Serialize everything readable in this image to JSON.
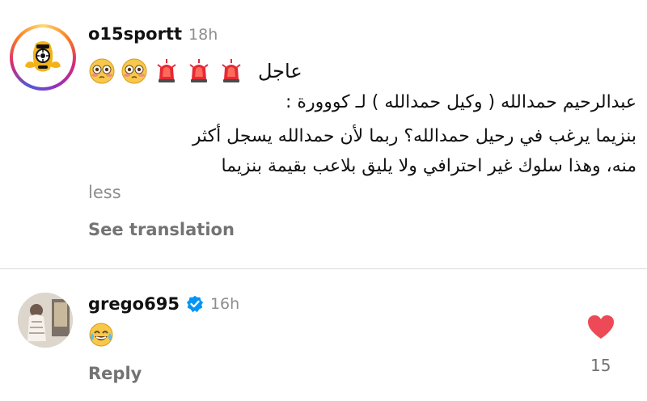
{
  "post": {
    "username": "o15sportt",
    "time": "18h",
    "emojis": [
      "flushed-face-emoji",
      "flushed-face-emoji",
      "police-light-emoji",
      "police-light-emoji",
      "police-light-emoji"
    ],
    "urgent_word": "عاجل",
    "line_1": "عبدالرحيم حمدالله ( وكيل حمدالله ) لـ كووورة :",
    "line_2": "بنزيما يرغب في رحيل حمدالله؟ ربما لأن حمدالله يسجل أكثر",
    "line_3": "منه، وهذا سلوك غير احترافي ولا يليق بلاعب بقيمة بنزيما",
    "less_label": "less",
    "see_translation_label": "See translation"
  },
  "reply": {
    "username": "grego695",
    "verified": true,
    "time": "16h",
    "emoji": "face-with-tears-of-joy-emoji",
    "reply_label": "Reply",
    "like_count": "15"
  },
  "colors": {
    "text": "#111111",
    "muted": "#8e8e8e",
    "action": "#737373",
    "verified": "#0095f6",
    "heart": "#ed4956",
    "divider": "#dbdbdb"
  }
}
